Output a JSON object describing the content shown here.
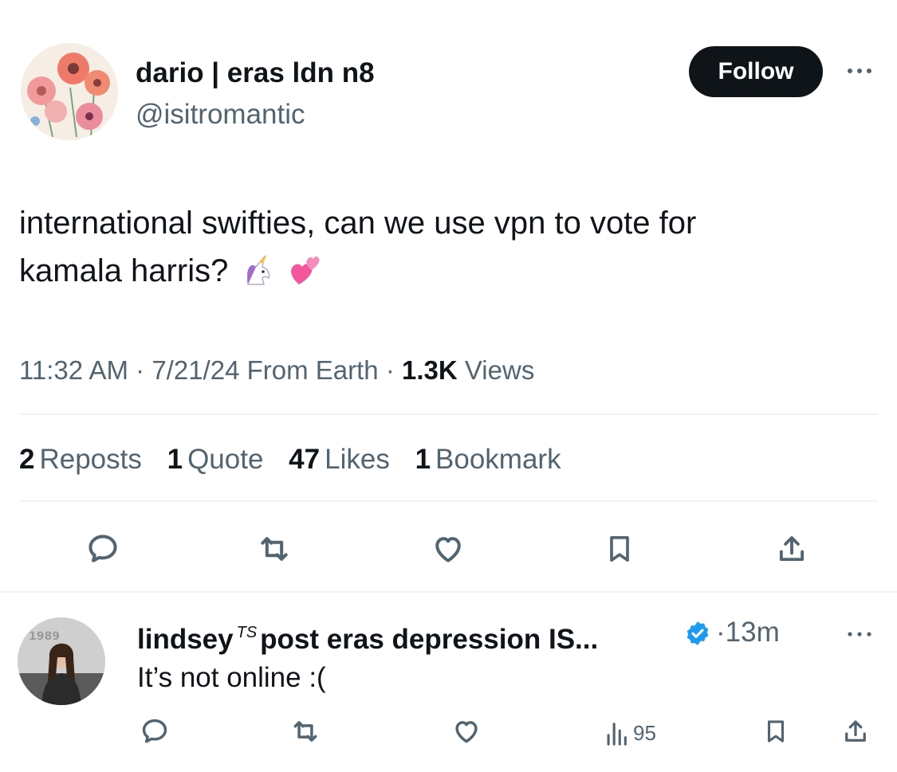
{
  "tweet": {
    "author": {
      "display_name": "dario | eras ldn n8",
      "handle": "@isitromantic"
    },
    "follow_label": "Follow",
    "text_line1": "international swifties, can we use vpn to vote for",
    "text_line2": "kamala harris?",
    "emojis": [
      "unicorn",
      "revolving-hearts"
    ],
    "meta": {
      "time": "11:32 AM",
      "date": "7/21/24",
      "source": "From Earth",
      "sep": "·",
      "views_count": "1.3K",
      "views_label": "Views"
    },
    "stats": [
      {
        "count": "2",
        "label": "Reposts"
      },
      {
        "count": "1",
        "label": "Quote"
      },
      {
        "count": "47",
        "label": "Likes"
      },
      {
        "count": "1",
        "label": "Bookmark"
      }
    ],
    "actions": [
      "reply-icon",
      "repost-icon",
      "like-icon",
      "bookmark-icon",
      "share-icon"
    ]
  },
  "reply": {
    "name_part1": "lindsey",
    "name_mark": "TS",
    "name_part2": "post eras depression IS...",
    "time_sep": "·",
    "time": "13m",
    "text": "It’s not online :(",
    "views": "95",
    "verified": true
  },
  "colors": {
    "text": "#0f1419",
    "secondary": "#536471",
    "divider": "#eff3f4",
    "verified": "#1d9bf0",
    "follow_bg": "#0f1419"
  }
}
